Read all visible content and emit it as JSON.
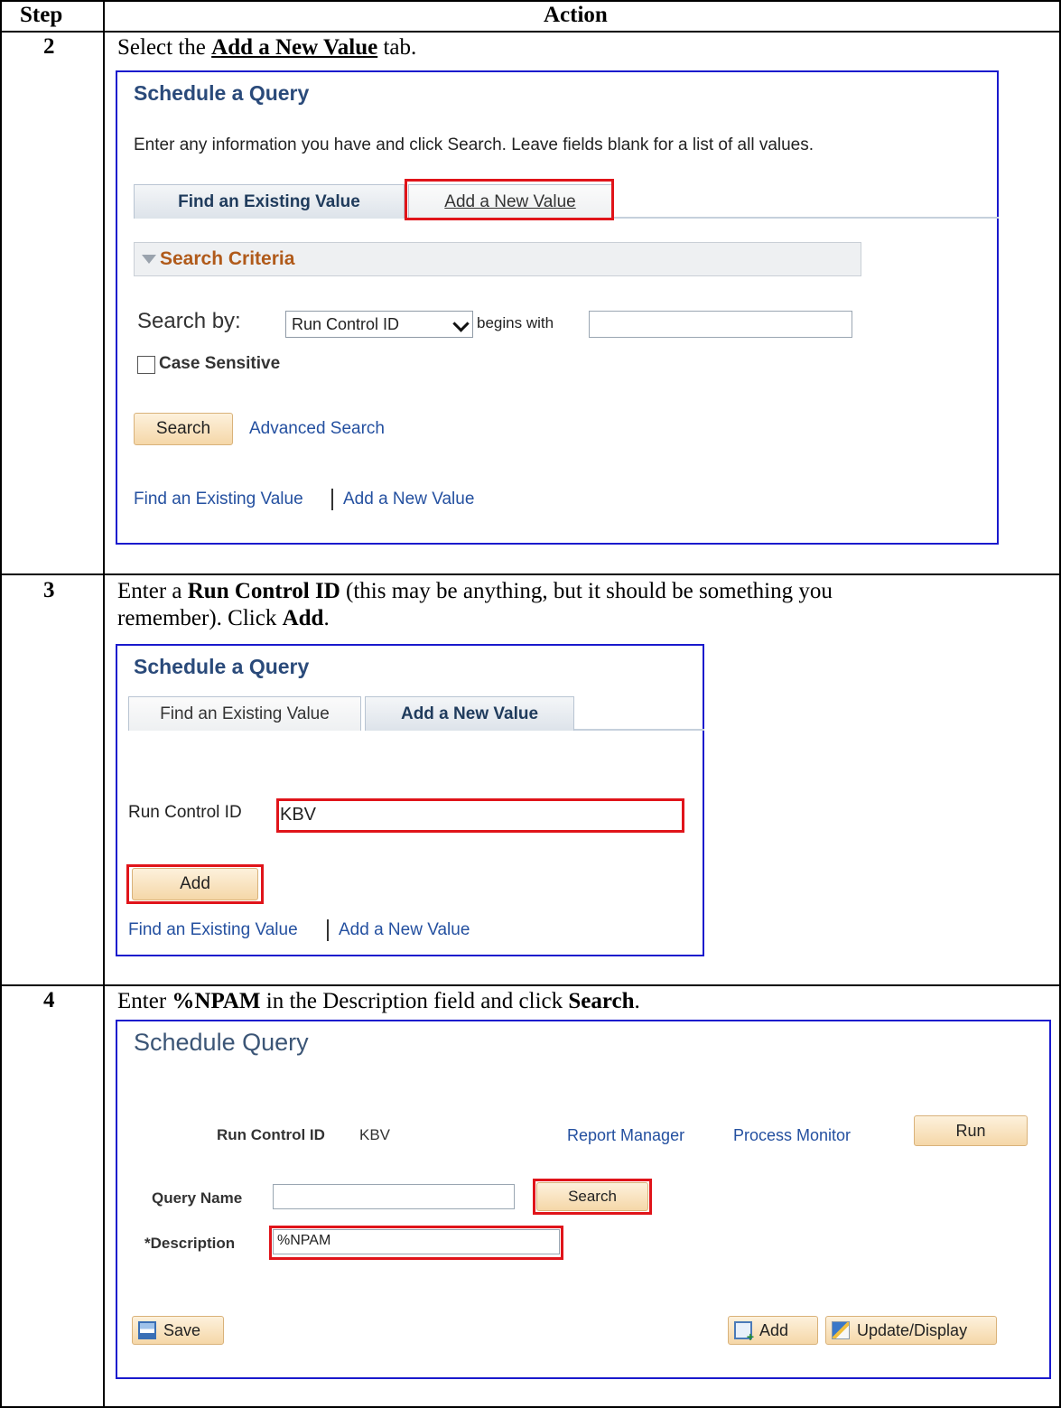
{
  "table": {
    "header_step": "Step",
    "header_action": "Action"
  },
  "step2": {
    "number": "2",
    "instruction_pre": "Select the ",
    "instruction_bold": "Add a New Value",
    "instruction_post": " tab.",
    "screen": {
      "title": "Schedule a Query",
      "help_text": "Enter any information you have and click Search. Leave fields blank for a list of all values.",
      "tab_find": "Find an Existing Value",
      "tab_add": "Add a New Value",
      "criteria_label": "Search Criteria",
      "search_by_label": "Search by:",
      "search_by_value": "Run Control ID",
      "begins_with": "begins with",
      "begins_with_value": "",
      "case_sensitive": "Case Sensitive",
      "search_button": "Search",
      "advanced_search": "Advanced Search",
      "footer_find": "Find an Existing Value",
      "footer_add": "Add a New Value"
    }
  },
  "step3": {
    "number": "3",
    "instruction_pre": "Enter a ",
    "instruction_bold": "Run Control ID",
    "instruction_post": " (this may be anything, but it should be something you",
    "instruction_line2_pre": "remember).  Click ",
    "instruction_line2_bold": "Add",
    "instruction_line2_post": ".",
    "screen": {
      "title": "Schedule a Query",
      "tab_find": "Find an Existing Value",
      "tab_add": "Add a New Value",
      "run_control_label": "Run Control ID",
      "run_control_value": "KBV",
      "add_button": "Add",
      "footer_find": "Find an Existing Value",
      "footer_add": "Add a New Value"
    }
  },
  "step4": {
    "number": "4",
    "instruction_pre": "Enter ",
    "instruction_bold": "%NPAM",
    "instruction_mid": " in the Description field and click ",
    "instruction_bold2": "Search",
    "instruction_post": ".",
    "screen": {
      "title": "Schedule Query",
      "run_control_label": "Run Control ID",
      "run_control_value": "KBV",
      "report_manager": "Report Manager",
      "process_monitor": "Process Monitor",
      "run_button": "Run",
      "query_name_label": "Query Name",
      "query_name_value": "",
      "search_button": "Search",
      "description_label": "*Description",
      "description_value": "%NPAM",
      "save_button": "Save",
      "add_button": "Add",
      "update_display_button": "Update/Display"
    }
  },
  "colors": {
    "highlight": "#e0141a",
    "screenshot_border": "#1a1acd",
    "link": "#2450a0",
    "title": "#2a4a7a",
    "criteria": "#b05a1a"
  }
}
